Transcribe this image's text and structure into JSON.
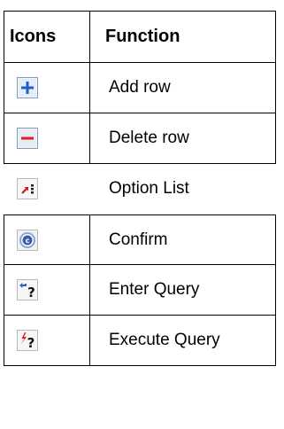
{
  "table": {
    "headers": {
      "icons": "Icons",
      "function": "Function"
    },
    "rows": [
      {
        "icon": "add-row-icon",
        "function": "Add row"
      },
      {
        "icon": "delete-row-icon",
        "function": "Delete row"
      },
      {
        "icon": "option-list-icon",
        "function": "Option List"
      },
      {
        "icon": "confirm-icon",
        "function": "Confirm"
      },
      {
        "icon": "enter-query-icon",
        "function": "Enter Query"
      },
      {
        "icon": "execute-query-icon",
        "function": "Execute Query"
      }
    ]
  },
  "colors": {
    "add_blue": "#1f5fc8",
    "delete_red": "#e02020",
    "icon_border": "#7f9db9"
  }
}
